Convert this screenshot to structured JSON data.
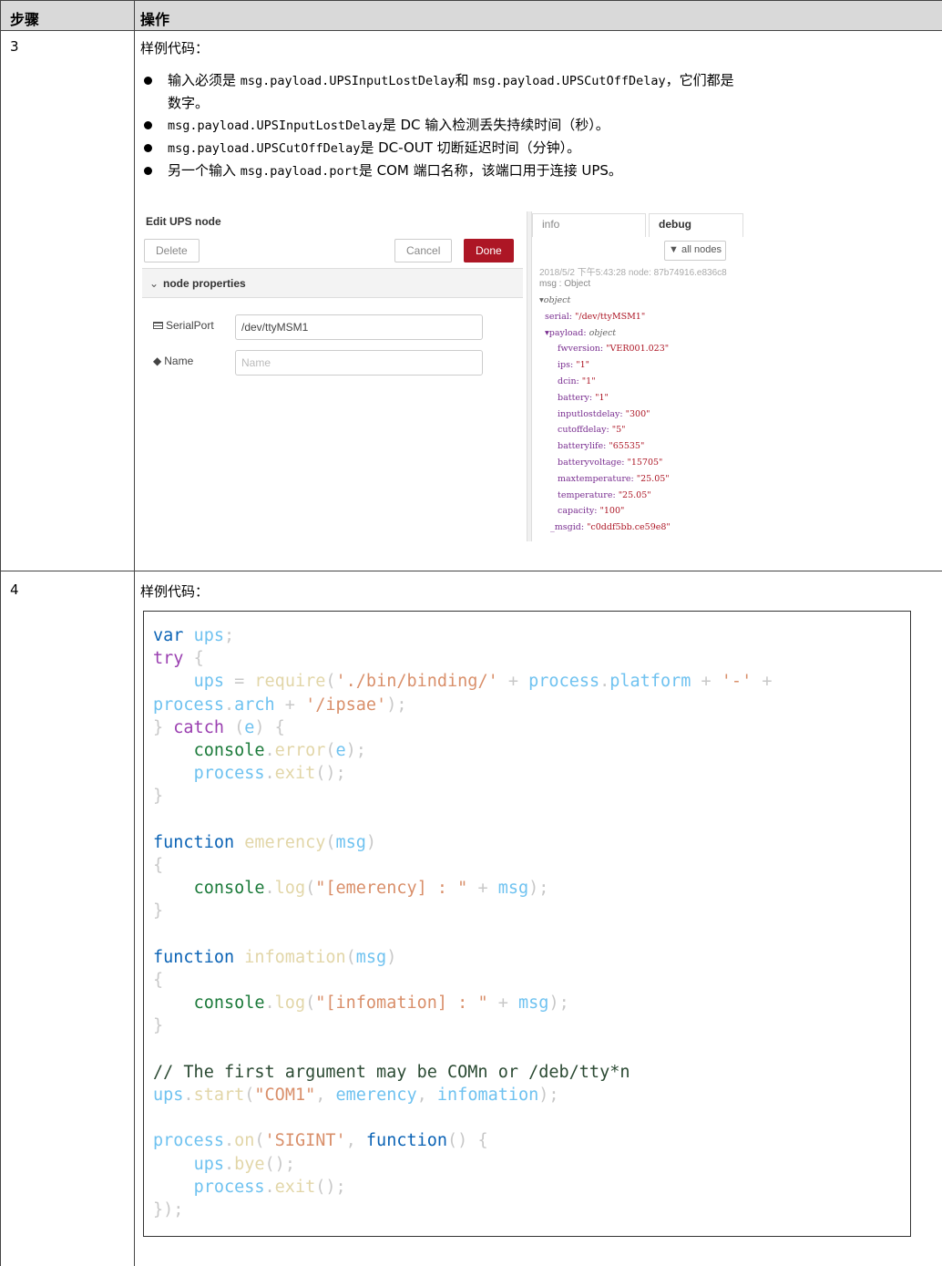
{
  "table": {
    "header": {
      "step": "步骤",
      "action": "操作"
    }
  },
  "rows": [
    {
      "step": "3",
      "intro": "样例代码：",
      "bullets": [
        {
          "a": "输入必须是 ",
          "b": "msg.payload.UPSInputLostDelay",
          "c": "和 ",
          "d": "msg.payload.UPSCutOffDelay",
          "e": "，它们都是"
        },
        {
          "cont": "数字。"
        },
        {
          "a": "",
          "b": "msg.payload.UPSInputLostDelay",
          "c": "是 DC 输入检测丢失持续时间（秒）。"
        },
        {
          "a": "",
          "b": "msg.payload.UPSCutOffDelay",
          "c": "是 DC-OUT 切断延迟时间（分钟）。"
        },
        {
          "a": "另一个输入 ",
          "b": "msg.payload.port",
          "c": "是 COM 端口名称，该端口用于连接 UPS。"
        }
      ],
      "screenshot": {
        "title": "Edit UPS node",
        "delete": "Delete",
        "cancel": "Cancel",
        "done": "Done",
        "section": "node properties",
        "serial_label": "SerialPort",
        "serial_value": "/dev/ttyMSM1",
        "name_label": "Name",
        "name_placeholder": "Name",
        "tab_info": "info",
        "tab_debug": "debug",
        "filter": "all nodes",
        "timestamp": "2018/5/2 下午5:43:28  node: 87b74916.e836c8",
        "msg_type": "msg : Object",
        "debug_lines": [
          {
            "k": "▾object",
            "v": "",
            "kind": "o"
          },
          {
            "k": "serial: ",
            "v": "\"/dev/ttyMSM1\""
          },
          {
            "k": "▾payload: ",
            "v": "object",
            "kind": "o"
          },
          {
            "k": "fwversion: ",
            "v": "\"VER001.023\""
          },
          {
            "k": "ips: ",
            "v": "\"1\""
          },
          {
            "k": "dcin: ",
            "v": "\"1\""
          },
          {
            "k": "battery: ",
            "v": "\"1\""
          },
          {
            "k": "inputlostdelay: ",
            "v": "\"300\""
          },
          {
            "k": "cutoffdelay: ",
            "v": "\"5\""
          },
          {
            "k": "batterylife: ",
            "v": "\"65535\""
          },
          {
            "k": "batteryvoltage: ",
            "v": "\"15705\""
          },
          {
            "k": "maxtemperature: ",
            "v": "\"25.05\""
          },
          {
            "k": "temperature: ",
            "v": "\"25.05\""
          },
          {
            "k": "capacity: ",
            "v": "\"100\""
          },
          {
            "k": "_msgid: ",
            "v": "\"c0ddf5bb.ce59e8\""
          }
        ]
      }
    },
    {
      "step": "4",
      "intro": "样例代码：",
      "code_lines": [
        [
          [
            "kw",
            "var "
          ],
          [
            "id",
            "ups"
          ],
          [
            "pu",
            ";"
          ]
        ],
        [
          [
            "kw2",
            "try "
          ],
          [
            "pu",
            "{"
          ]
        ],
        [
          [
            "pu",
            "    "
          ],
          [
            "id",
            "ups"
          ],
          [
            "pu",
            " = "
          ],
          [
            "fn",
            "require"
          ],
          [
            "pu",
            "("
          ],
          [
            "str",
            "'./bin/binding/'"
          ],
          [
            "pu",
            " + "
          ],
          [
            "id",
            "process"
          ],
          [
            "pu",
            "."
          ],
          [
            "id",
            "platform"
          ],
          [
            "pu",
            " + "
          ],
          [
            "str",
            "'-'"
          ],
          [
            "pu",
            " +"
          ]
        ],
        [
          [
            "id",
            "process"
          ],
          [
            "pu",
            "."
          ],
          [
            "id",
            "arch"
          ],
          [
            "pu",
            " + "
          ],
          [
            "str",
            "'/ipsae'"
          ],
          [
            "pu",
            ");"
          ]
        ],
        [
          [
            "pu",
            "} "
          ],
          [
            "kw2",
            "catch"
          ],
          [
            "pu",
            " ("
          ],
          [
            "id",
            "e"
          ],
          [
            "pu",
            ") {"
          ]
        ],
        [
          [
            "pu",
            "    "
          ],
          [
            "tx",
            "console"
          ],
          [
            "pu",
            "."
          ],
          [
            "fn",
            "error"
          ],
          [
            "pu",
            "("
          ],
          [
            "id",
            "e"
          ],
          [
            "pu",
            ");"
          ]
        ],
        [
          [
            "pu",
            "    "
          ],
          [
            "id",
            "process"
          ],
          [
            "pu",
            "."
          ],
          [
            "fn",
            "exit"
          ],
          [
            "pu",
            "();"
          ]
        ],
        [
          [
            "pu",
            "}"
          ]
        ],
        [
          [
            "pu",
            ""
          ]
        ],
        [
          [
            "kw",
            "function "
          ],
          [
            "fn",
            "emerency"
          ],
          [
            "pu",
            "("
          ],
          [
            "id",
            "msg"
          ],
          [
            "pu",
            ")"
          ]
        ],
        [
          [
            "pu",
            "{"
          ]
        ],
        [
          [
            "pu",
            "    "
          ],
          [
            "tx",
            "console"
          ],
          [
            "pu",
            "."
          ],
          [
            "fn",
            "log"
          ],
          [
            "pu",
            "("
          ],
          [
            "str",
            "\"[emerency] : \""
          ],
          [
            "pu",
            " + "
          ],
          [
            "id",
            "msg"
          ],
          [
            "pu",
            ");"
          ]
        ],
        [
          [
            "pu",
            "}"
          ]
        ],
        [
          [
            "pu",
            ""
          ]
        ],
        [
          [
            "kw",
            "function "
          ],
          [
            "fn",
            "infomation"
          ],
          [
            "pu",
            "("
          ],
          [
            "id",
            "msg"
          ],
          [
            "pu",
            ")"
          ]
        ],
        [
          [
            "pu",
            "{"
          ]
        ],
        [
          [
            "pu",
            "    "
          ],
          [
            "tx",
            "console"
          ],
          [
            "pu",
            "."
          ],
          [
            "fn",
            "log"
          ],
          [
            "pu",
            "("
          ],
          [
            "str",
            "\"[infomation] : \""
          ],
          [
            "pu",
            " + "
          ],
          [
            "id",
            "msg"
          ],
          [
            "pu",
            ");"
          ]
        ],
        [
          [
            "pu",
            "}"
          ]
        ],
        [
          [
            "pu",
            ""
          ]
        ],
        [
          [
            "cm",
            "// The first argument may be COMn or /deb/tty*n"
          ]
        ],
        [
          [
            "id",
            "ups"
          ],
          [
            "pu",
            "."
          ],
          [
            "fn",
            "start"
          ],
          [
            "pu",
            "("
          ],
          [
            "str",
            "\"COM1\""
          ],
          [
            "pu",
            ", "
          ],
          [
            "id",
            "emerency"
          ],
          [
            "pu",
            ", "
          ],
          [
            "id",
            "infomation"
          ],
          [
            "pu",
            ");"
          ]
        ],
        [
          [
            "pu",
            ""
          ]
        ],
        [
          [
            "id",
            "process"
          ],
          [
            "pu",
            "."
          ],
          [
            "fn",
            "on"
          ],
          [
            "pu",
            "("
          ],
          [
            "str",
            "'SIGINT'"
          ],
          [
            "pu",
            ", "
          ],
          [
            "kw",
            "function"
          ],
          [
            "pu",
            "() {"
          ]
        ],
        [
          [
            "pu",
            "    "
          ],
          [
            "id",
            "ups"
          ],
          [
            "pu",
            "."
          ],
          [
            "fn",
            "bye"
          ],
          [
            "pu",
            "();"
          ]
        ],
        [
          [
            "pu",
            "    "
          ],
          [
            "id",
            "process"
          ],
          [
            "pu",
            "."
          ],
          [
            "fn",
            "exit"
          ],
          [
            "pu",
            "();"
          ]
        ],
        [
          [
            "pu",
            "});"
          ]
        ]
      ]
    }
  ]
}
